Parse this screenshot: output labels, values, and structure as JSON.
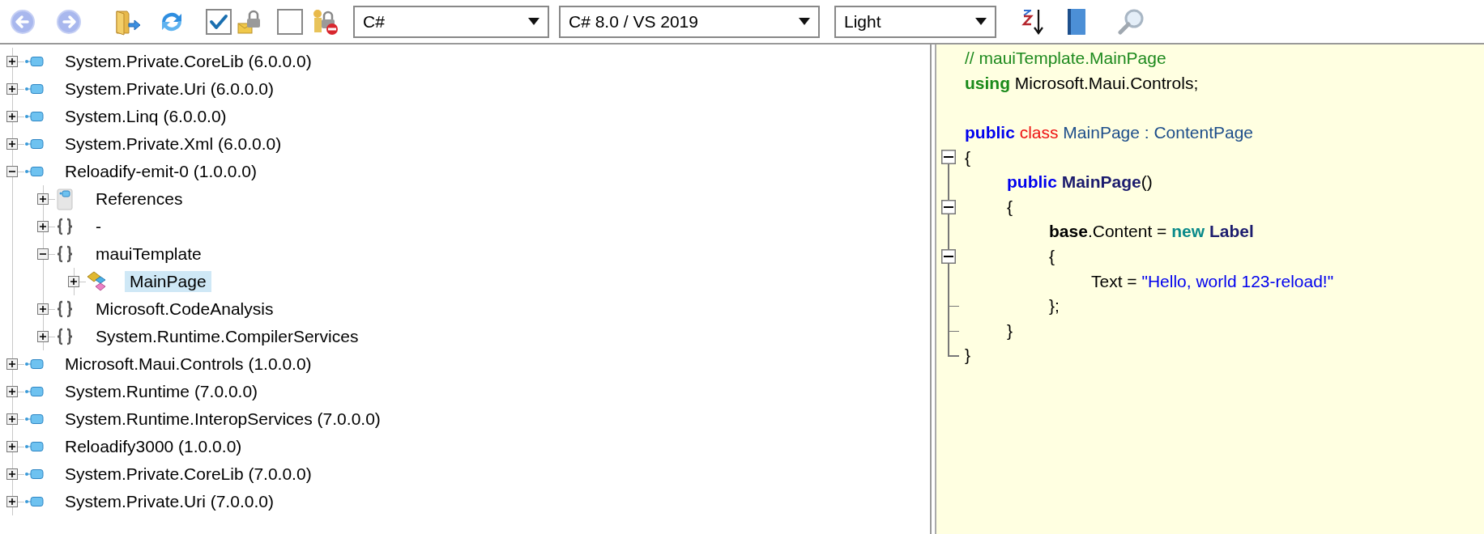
{
  "toolbar": {
    "checkboxes": [
      {
        "checked": true
      },
      {
        "checked": false
      }
    ],
    "dropdowns": [
      {
        "value": "C#"
      },
      {
        "value": "C# 8.0 / VS 2019"
      },
      {
        "value": "Light"
      }
    ]
  },
  "tree": [
    {
      "label": "System.Private.CoreLib (6.0.0.0)",
      "kind": "assembly",
      "expanded": false,
      "selected": false
    },
    {
      "label": "System.Private.Uri (6.0.0.0)",
      "kind": "assembly",
      "expanded": false,
      "selected": false
    },
    {
      "label": "System.Linq (6.0.0.0)",
      "kind": "assembly",
      "expanded": false,
      "selected": false
    },
    {
      "label": "System.Private.Xml (6.0.0.0)",
      "kind": "assembly",
      "expanded": false,
      "selected": false
    },
    {
      "label": "Reloadify-emit-0 (1.0.0.0)",
      "kind": "assembly",
      "expanded": true,
      "selected": false,
      "children": [
        {
          "label": "References",
          "kind": "references",
          "expanded": false,
          "selected": false
        },
        {
          "label": "-",
          "kind": "namespace",
          "expanded": false,
          "selected": false
        },
        {
          "label": "mauiTemplate",
          "kind": "namespace",
          "expanded": true,
          "selected": false,
          "children": [
            {
              "label": "MainPage",
              "kind": "class",
              "expanded": false,
              "selected": true
            }
          ]
        },
        {
          "label": "Microsoft.CodeAnalysis",
          "kind": "namespace",
          "expanded": false,
          "selected": false
        },
        {
          "label": "System.Runtime.CompilerServices",
          "kind": "namespace",
          "expanded": false,
          "selected": false
        }
      ]
    },
    {
      "label": "Microsoft.Maui.Controls (1.0.0.0)",
      "kind": "assembly",
      "expanded": false,
      "selected": false
    },
    {
      "label": "System.Runtime (7.0.0.0)",
      "kind": "assembly",
      "expanded": false,
      "selected": false
    },
    {
      "label": "System.Runtime.InteropServices (7.0.0.0)",
      "kind": "assembly",
      "expanded": false,
      "selected": false
    },
    {
      "label": "Reloadify3000 (1.0.0.0)",
      "kind": "assembly",
      "expanded": false,
      "selected": false
    },
    {
      "label": "System.Private.CoreLib (7.0.0.0)",
      "kind": "assembly",
      "expanded": false,
      "selected": false
    },
    {
      "label": "System.Private.Uri (7.0.0.0)",
      "kind": "assembly",
      "expanded": false,
      "selected": false
    }
  ],
  "code": [
    {
      "kind": "plain",
      "tokens": [
        {
          "kind": "comment",
          "text": "// mauiTemplate.MainPage"
        }
      ]
    },
    {
      "kind": "plain",
      "tokens": [
        {
          "kind": "directive",
          "text": "using"
        },
        {
          "kind": "plain",
          "text": " Microsoft.Maui.Controls;"
        }
      ]
    },
    {
      "kind": "blank"
    },
    {
      "kind": "plain",
      "tokens": [
        {
          "kind": "keyword",
          "text": "public "
        },
        {
          "kind": "class-keyword",
          "text": "class "
        },
        {
          "kind": "type",
          "text": "MainPage"
        },
        {
          "kind": "type",
          "text": " : "
        },
        {
          "kind": "type",
          "text": "ContentPage"
        }
      ]
    },
    {
      "kind": "fold-open",
      "tokens": [
        {
          "kind": "plain",
          "text": "{"
        }
      ]
    },
    {
      "kind": "fold-line",
      "tokens": [
        {
          "kind": "keyword",
          "text": "\tpublic "
        },
        {
          "kind": "member",
          "text": "MainPage"
        },
        {
          "kind": "plain",
          "text": "()"
        }
      ]
    },
    {
      "kind": "fold-collapse",
      "tokens": [
        {
          "kind": "plain",
          "text": "\t{"
        }
      ]
    },
    {
      "kind": "fold-line",
      "tokens": [
        {
          "kind": "base",
          "text": "\t\tbase"
        },
        {
          "kind": "plain",
          "text": ".Content = "
        },
        {
          "kind": "new-keyword",
          "text": "new "
        },
        {
          "kind": "member",
          "text": "Label"
        }
      ]
    },
    {
      "kind": "fold-collapse",
      "tokens": [
        {
          "kind": "plain",
          "text": "\t\t{"
        }
      ]
    },
    {
      "kind": "fold-line",
      "tokens": [
        {
          "kind": "plain",
          "text": "\t\t\tText = "
        },
        {
          "kind": "string",
          "text": "\"Hello, world 123-reload!\""
        }
      ]
    },
    {
      "kind": "fold-tee",
      "tokens": [
        {
          "kind": "plain",
          "text": "\t\t};"
        }
      ]
    },
    {
      "kind": "fold-tee",
      "tokens": [
        {
          "kind": "plain",
          "text": "\t}"
        }
      ]
    },
    {
      "kind": "fold-end",
      "tokens": [
        {
          "kind": "plain",
          "text": "}"
        }
      ]
    }
  ]
}
